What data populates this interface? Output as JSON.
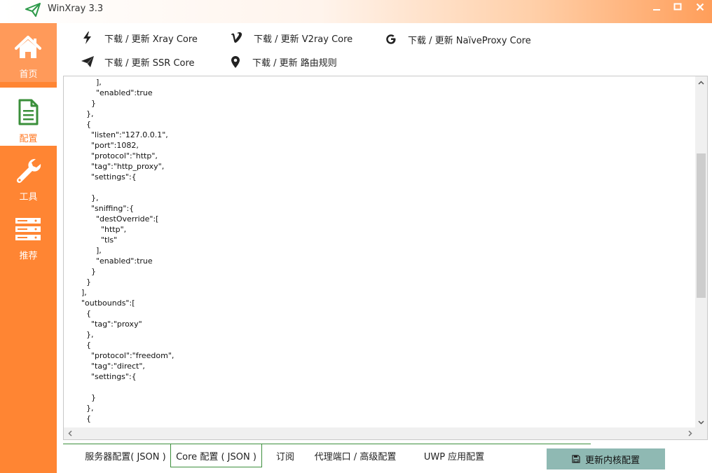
{
  "window": {
    "title": "WinXray 3.3"
  },
  "sidebar": {
    "items": [
      {
        "label": "首页",
        "icon": "home-icon"
      },
      {
        "label": "配置",
        "icon": "document-icon"
      },
      {
        "label": "工具",
        "icon": "wrench-icon"
      },
      {
        "label": "推荐",
        "icon": "server-icon"
      }
    ],
    "active": "配置"
  },
  "downloads": [
    {
      "label": "下载 / 更新 Xray Core",
      "icon": "lightning-icon"
    },
    {
      "label": "下载 / 更新 V2ray Core",
      "icon": "v-logo-icon"
    },
    {
      "label": "下载 / 更新 NaïveProxy Core",
      "icon": "google-icon"
    },
    {
      "label": "下载 / 更新 SSR Core",
      "icon": "paper-plane-icon"
    },
    {
      "label": "下载 / 更新 路由规则",
      "icon": "map-pin-icon"
    }
  ],
  "editor": {
    "lines": [
      "        ],",
      "        \"enabled\":true",
      "      }",
      "    },",
      "    {",
      "      \"listen\":\"127.0.0.1\",",
      "      \"port\":1082,",
      "      \"protocol\":\"http\",",
      "      \"tag\":\"http_proxy\",",
      "      \"settings\":{",
      "",
      "      },",
      "      \"sniffing\":{",
      "        \"destOverride\":[",
      "          \"http\",",
      "          \"tls\"",
      "        ],",
      "        \"enabled\":true",
      "      }",
      "    }",
      "  ],",
      "  \"outbounds\":[",
      "    {",
      "      \"tag\":\"proxy\"",
      "    },",
      "    {",
      "      \"protocol\":\"freedom\",",
      "      \"tag\":\"direct\",",
      "      \"settings\":{",
      "",
      "      }",
      "    },",
      "    {"
    ]
  },
  "tabs": [
    {
      "label": "服务器配置( JSON )"
    },
    {
      "label": "Core 配置 ( JSON )"
    },
    {
      "label": "订阅"
    },
    {
      "label": "代理端口 / 高级配置"
    },
    {
      "label": "UWP 应用配置"
    }
  ],
  "active_tab": "Core 配置 ( JSON )",
  "actions": {
    "update_label": "更新内核配置",
    "update_icon": "save-icon"
  },
  "colors": {
    "sidebar": "#ff8533",
    "accent": "#ff7a26",
    "tab_border": "#3d8f3d",
    "update_button": "#8fb9b3"
  }
}
